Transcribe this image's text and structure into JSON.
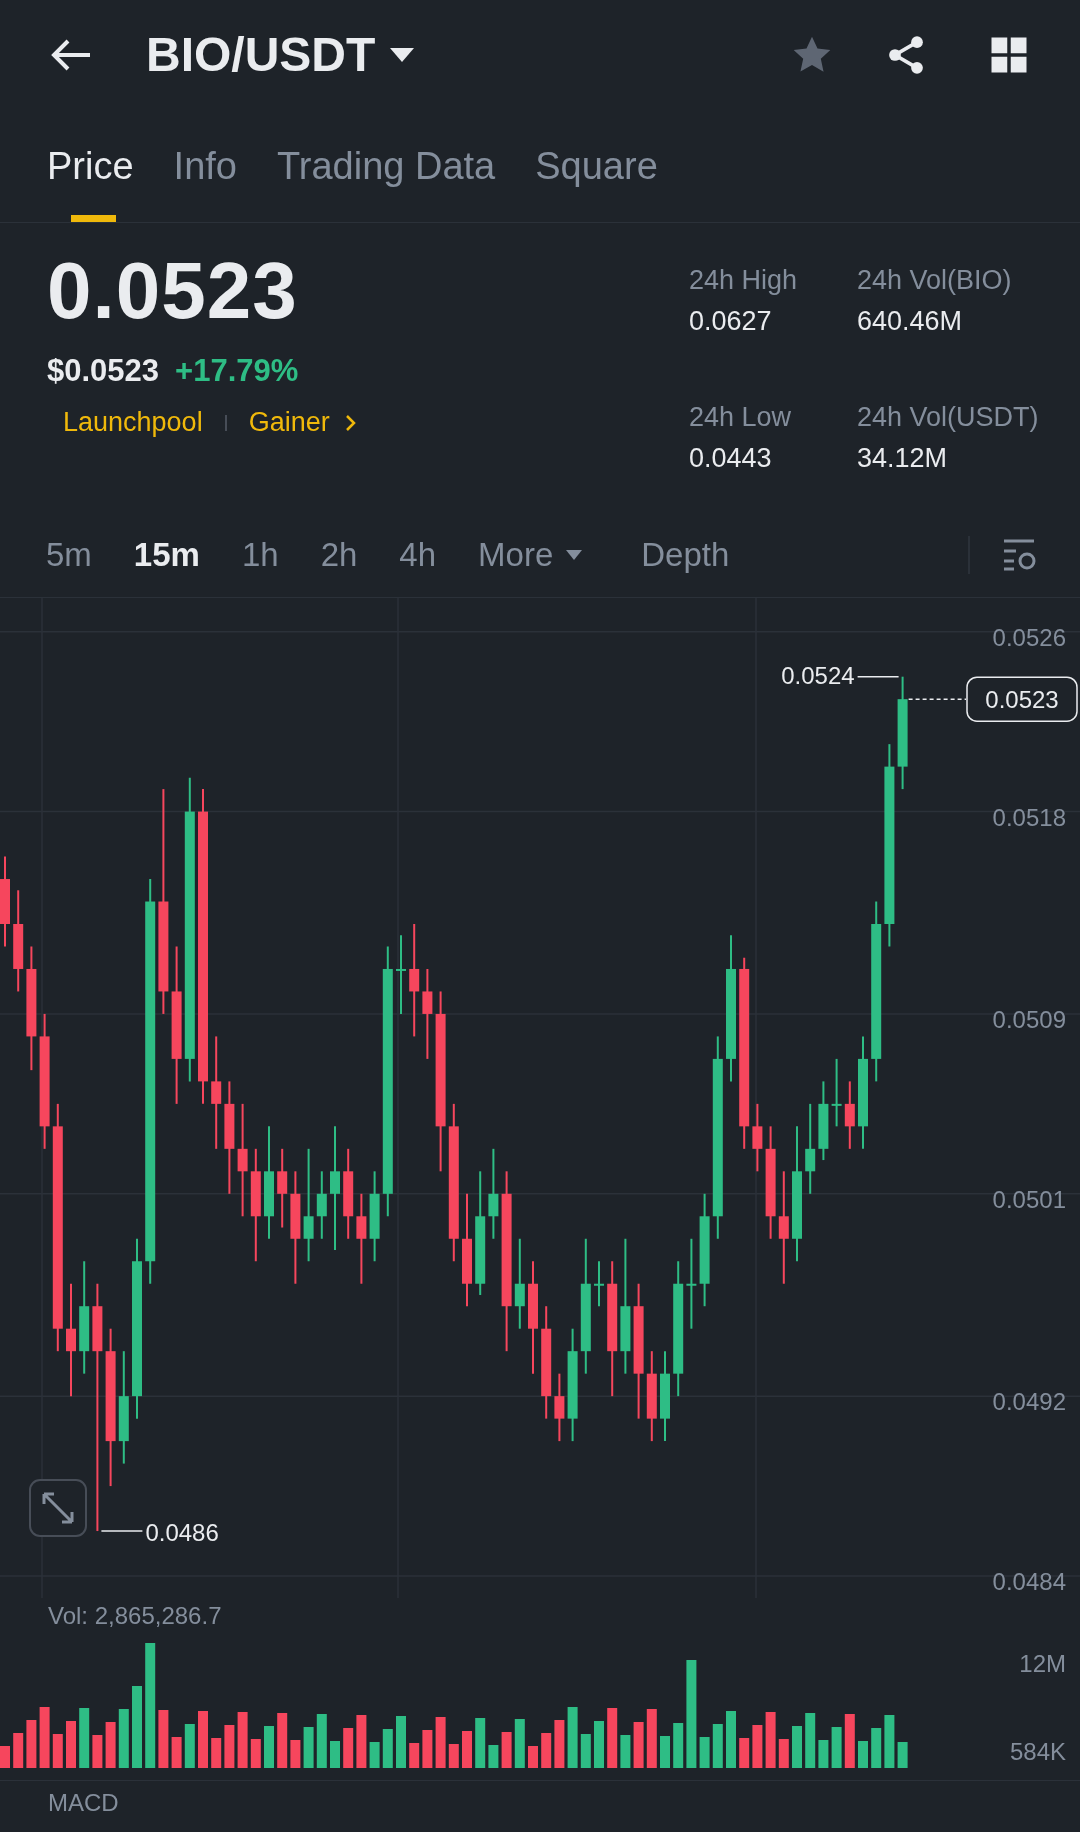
{
  "header": {
    "title": "BIO/USDT"
  },
  "tabs": [
    {
      "label": "Price",
      "selected": true
    },
    {
      "label": "Info",
      "selected": false
    },
    {
      "label": "Trading Data",
      "selected": false
    },
    {
      "label": "Square",
      "selected": false
    }
  ],
  "ticker": {
    "last_price": "0.0523",
    "fiat_price": "$0.0523",
    "change": "+17.79%",
    "tags": [
      {
        "label": "Launchpool",
        "kind": "tag"
      },
      {
        "label": "Gainer",
        "kind": "link"
      }
    ],
    "stats": [
      {
        "label": "24h High",
        "value": "0.0627"
      },
      {
        "label": "24h Vol(BIO)",
        "value": "640.46M"
      },
      {
        "label": "24h Low",
        "value": "0.0443"
      },
      {
        "label": "24h Vol(USDT)",
        "value": "34.12M"
      }
    ]
  },
  "intervals": [
    {
      "label": "5m",
      "kind": "interval",
      "selected": false
    },
    {
      "label": "15m",
      "kind": "interval",
      "selected": true
    },
    {
      "label": "1h",
      "kind": "interval",
      "selected": false
    },
    {
      "label": "2h",
      "kind": "interval",
      "selected": false
    },
    {
      "label": "4h",
      "kind": "interval",
      "selected": false
    },
    {
      "label": "More",
      "kind": "menu",
      "selected": false
    },
    {
      "label": "Depth",
      "kind": "interval",
      "selected": false
    }
  ],
  "chart": {
    "high_label": "0.0524",
    "low_label": "0.0486",
    "current_label": "0.0523",
    "chart_data": {
      "type": "candlestick",
      "ylim": [
        0.04832,
        0.05275
      ],
      "grid": true,
      "yticks": [
        0.0526,
        0.0518,
        0.0509,
        0.0501,
        0.0492,
        0.0484
      ],
      "ohlc": [
        [
          0.0515,
          0.0516,
          0.0512,
          0.0513
        ],
        [
          0.0513,
          0.05145,
          0.051,
          0.0511
        ],
        [
          0.0511,
          0.0512,
          0.05065,
          0.0508
        ],
        [
          0.0508,
          0.0509,
          0.0503,
          0.0504
        ],
        [
          0.0504,
          0.0505,
          0.0494,
          0.0495
        ],
        [
          0.0495,
          0.0497,
          0.0492,
          0.0494
        ],
        [
          0.0494,
          0.0498,
          0.0493,
          0.0496
        ],
        [
          0.0496,
          0.0497,
          0.0486,
          0.0494
        ],
        [
          0.0494,
          0.0495,
          0.0488,
          0.049
        ],
        [
          0.049,
          0.0494,
          0.0489,
          0.0492
        ],
        [
          0.0492,
          0.0499,
          0.0491,
          0.0498
        ],
        [
          0.0498,
          0.0515,
          0.0497,
          0.0514
        ],
        [
          0.0514,
          0.0519,
          0.0509,
          0.051
        ],
        [
          0.051,
          0.0512,
          0.0505,
          0.0507
        ],
        [
          0.0507,
          0.05195,
          0.0506,
          0.0518
        ],
        [
          0.0518,
          0.0519,
          0.0505,
          0.0506
        ],
        [
          0.0506,
          0.0508,
          0.0503,
          0.0505
        ],
        [
          0.0505,
          0.0506,
          0.0501,
          0.0503
        ],
        [
          0.0503,
          0.0505,
          0.05,
          0.0502
        ],
        [
          0.0502,
          0.0503,
          0.0498,
          0.05
        ],
        [
          0.05,
          0.0504,
          0.0499,
          0.0502
        ],
        [
          0.0502,
          0.0503,
          0.04995,
          0.0501
        ],
        [
          0.0501,
          0.0502,
          0.0497,
          0.0499
        ],
        [
          0.0499,
          0.0503,
          0.0498,
          0.05
        ],
        [
          0.05,
          0.0502,
          0.0499,
          0.0501
        ],
        [
          0.0501,
          0.0504,
          0.04985,
          0.0502
        ],
        [
          0.0502,
          0.0503,
          0.0499,
          0.05
        ],
        [
          0.05,
          0.0501,
          0.0497,
          0.0499
        ],
        [
          0.0499,
          0.0502,
          0.0498,
          0.0501
        ],
        [
          0.0501,
          0.0512,
          0.05,
          0.0511
        ],
        [
          0.0511,
          0.05125,
          0.0509,
          0.0511
        ],
        [
          0.0511,
          0.0513,
          0.0508,
          0.051
        ],
        [
          0.051,
          0.0511,
          0.0507,
          0.0509
        ],
        [
          0.0509,
          0.051,
          0.0502,
          0.0504
        ],
        [
          0.0504,
          0.0505,
          0.0498,
          0.0499
        ],
        [
          0.0499,
          0.0501,
          0.0496,
          0.0497
        ],
        [
          0.0497,
          0.0502,
          0.04965,
          0.05
        ],
        [
          0.05,
          0.0503,
          0.0499,
          0.0501
        ],
        [
          0.0501,
          0.0502,
          0.0494,
          0.0496
        ],
        [
          0.0496,
          0.0499,
          0.0495,
          0.0497
        ],
        [
          0.0497,
          0.0498,
          0.0493,
          0.0495
        ],
        [
          0.0495,
          0.0496,
          0.0491,
          0.0492
        ],
        [
          0.0492,
          0.0493,
          0.049,
          0.0491
        ],
        [
          0.0491,
          0.0495,
          0.049,
          0.0494
        ],
        [
          0.0494,
          0.0499,
          0.0493,
          0.0497
        ],
        [
          0.0497,
          0.0498,
          0.0496,
          0.0497
        ],
        [
          0.0497,
          0.0498,
          0.0492,
          0.0494
        ],
        [
          0.0494,
          0.0499,
          0.0493,
          0.0496
        ],
        [
          0.0496,
          0.0497,
          0.0491,
          0.0493
        ],
        [
          0.0493,
          0.0494,
          0.049,
          0.0491
        ],
        [
          0.0491,
          0.0494,
          0.049,
          0.0493
        ],
        [
          0.0493,
          0.0498,
          0.0492,
          0.0497
        ],
        [
          0.0497,
          0.0499,
          0.0495,
          0.0497
        ],
        [
          0.0497,
          0.0501,
          0.0496,
          0.05
        ],
        [
          0.05,
          0.0508,
          0.0499,
          0.0507
        ],
        [
          0.0507,
          0.05125,
          0.0506,
          0.0511
        ],
        [
          0.0511,
          0.05115,
          0.0503,
          0.0504
        ],
        [
          0.0504,
          0.0505,
          0.0502,
          0.0503
        ],
        [
          0.0503,
          0.0504,
          0.0499,
          0.05
        ],
        [
          0.05,
          0.0502,
          0.0497,
          0.0499
        ],
        [
          0.0499,
          0.0504,
          0.0498,
          0.0502
        ],
        [
          0.0502,
          0.0505,
          0.0501,
          0.0503
        ],
        [
          0.0503,
          0.0506,
          0.05025,
          0.0505
        ],
        [
          0.0505,
          0.0507,
          0.0504,
          0.0505
        ],
        [
          0.0505,
          0.0506,
          0.0503,
          0.0504
        ],
        [
          0.0504,
          0.0508,
          0.0503,
          0.0507
        ],
        [
          0.0507,
          0.0514,
          0.0506,
          0.0513
        ],
        [
          0.0513,
          0.0521,
          0.0512,
          0.052
        ],
        [
          0.052,
          0.0524,
          0.0519,
          0.0523
        ]
      ]
    }
  },
  "volume": {
    "label": "Vol: 2,865,286.7",
    "scale_labels": [
      "12M",
      "584K"
    ]
  },
  "indicator": {
    "label": "MACD"
  }
}
